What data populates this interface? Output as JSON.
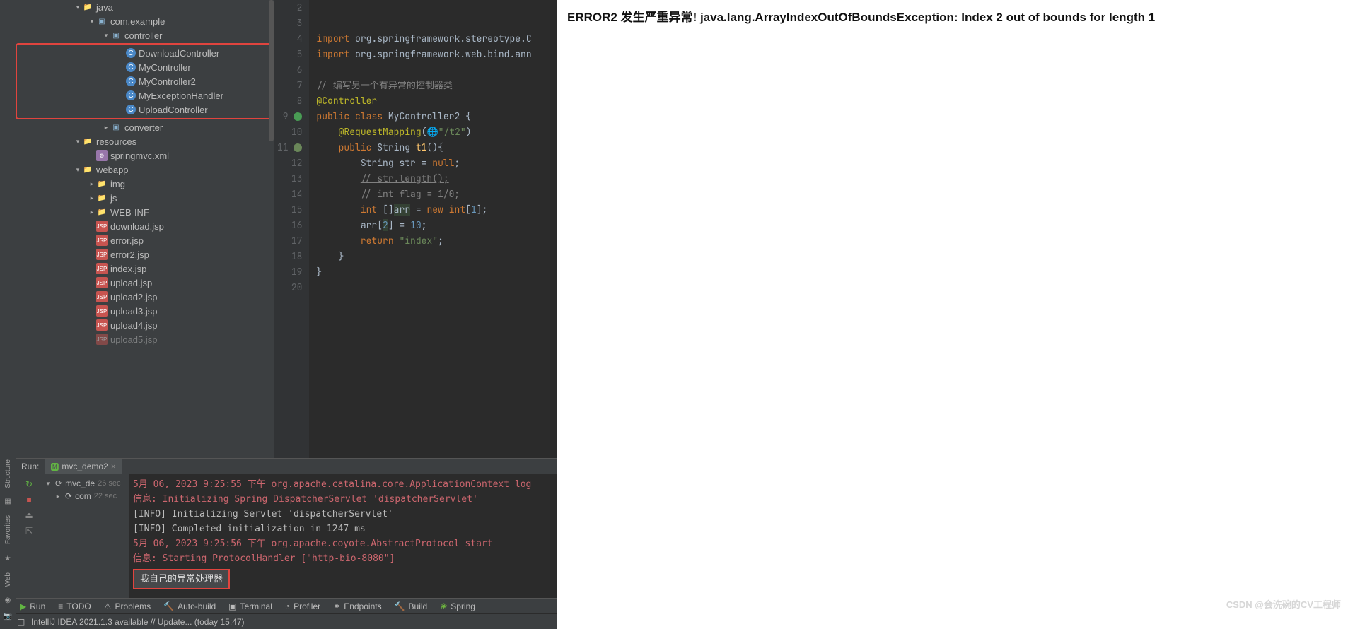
{
  "browser": {
    "error_text": "ERROR2 发生严重异常! java.lang.ArrayIndexOutOfBoundsException: Index 2 out of bounds for length 1"
  },
  "vrail": {
    "structure": "Structure",
    "favorites": "Favorites",
    "web": "Web"
  },
  "tree": {
    "java": "java",
    "pkg": "com.example",
    "controller": "controller",
    "classes": [
      "DownloadController",
      "MyController",
      "MyController2",
      "MyExceptionHandler",
      "UploadController"
    ],
    "converter": "converter",
    "resources": "resources",
    "springxml": "springmvc.xml",
    "webapp": "webapp",
    "img": "img",
    "js": "js",
    "webinf": "WEB-INF",
    "jsps": [
      "download.jsp",
      "error.jsp",
      "error2.jsp",
      "index.jsp",
      "upload.jsp",
      "upload2.jsp",
      "upload3.jsp",
      "upload4.jsp",
      "upload5.jsp"
    ]
  },
  "editor": {
    "lines": [
      "2",
      "3",
      "4",
      "5",
      "6",
      "7",
      "8",
      "9",
      "10",
      "11",
      "12",
      "13",
      "14",
      "15",
      "16",
      "17",
      "18",
      "19",
      "20"
    ],
    "import1_kw": "import",
    "import1": "org.springframework.stereotype.C",
    "import2_kw": "import",
    "import2": "org.springframework.web.bind.ann",
    "cmt1": "// 编写另一个有异常的控制器类",
    "ann_ctrl": "@Controller",
    "pub": "public",
    "cls": "class",
    "clsname": "MyController2",
    "ann_rm": "@RequestMapping",
    "rm_val": "\"/t2\"",
    "pub2": "public",
    "rettype": "String",
    "fn": "t1",
    "l12_type": "String",
    "l12_var": "str",
    "l12_null": "null",
    "l13": "// str.length();",
    "l14": "// int flag = 1/0;",
    "l15_int": "int",
    "l15_arr": "arr",
    "l15_new": "new",
    "l15_int2": "int",
    "l15_n": "1",
    "l16_arr": "arr",
    "l16_idx": "2",
    "l16_val": "10",
    "l17_ret": "return",
    "l17_str": "\"index\""
  },
  "run": {
    "label": "Run:",
    "tab": "mvc_demo2",
    "tree_root": "mvc_de",
    "tree_root_time": "26 sec",
    "tree_child": "com",
    "tree_child_time": "22 sec",
    "line1": "5月 06, 2023 9:25:55 下午 org.apache.catalina.core.ApplicationContext log",
    "line2": "信息: Initializing Spring DispatcherServlet 'dispatcherServlet'",
    "line3": "[INFO] Initializing Servlet 'dispatcherServlet'",
    "line4": "[INFO] Completed initialization in 1247 ms",
    "line5": "5月 06, 2023 9:25:56 下午 org.apache.coyote.AbstractProtocol start",
    "line6": "信息: Starting ProtocolHandler [\"http-bio-8080\"]",
    "box": "我自己的异常处理器"
  },
  "toolwin": {
    "run": "Run",
    "todo": "TODO",
    "problems": "Problems",
    "auto": "Auto-build",
    "terminal": "Terminal",
    "profiler": "Profiler",
    "endpoints": "Endpoints",
    "build": "Build",
    "spring": "Spring"
  },
  "status": {
    "text": "IntelliJ IDEA 2021.1.3 available // Update... (today 15:47)"
  },
  "watermark": "CSDN @会洗碗的CV工程师"
}
